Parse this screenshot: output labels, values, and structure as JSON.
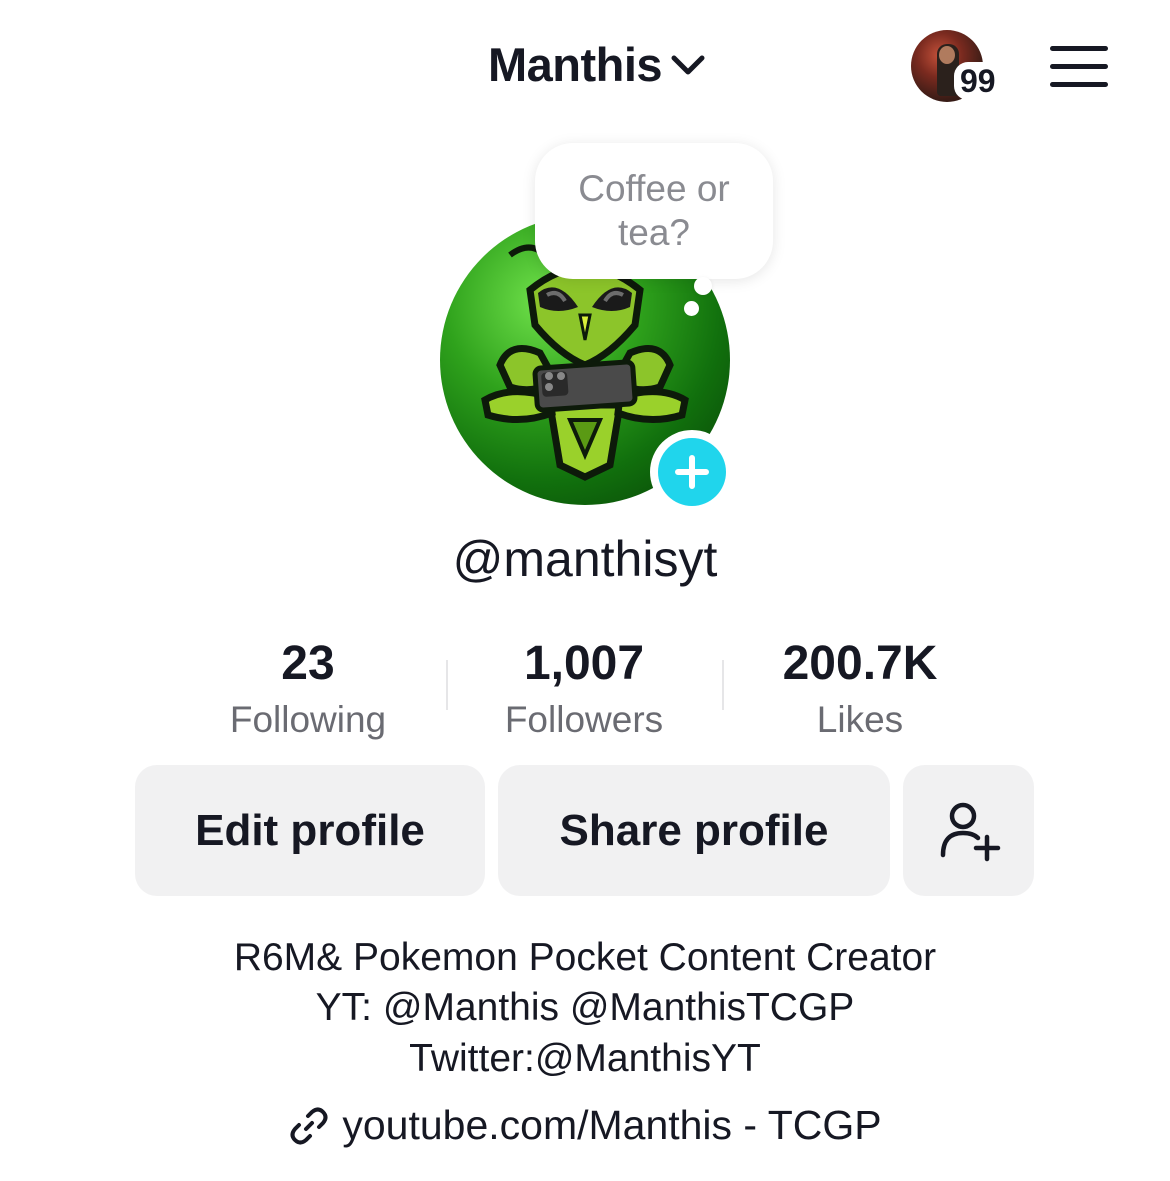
{
  "header": {
    "profile_name": "Manthis",
    "notification_count": "99"
  },
  "bubble": {
    "text": "Coffee or tea?"
  },
  "profile": {
    "username": "@manthisyt"
  },
  "stats": [
    {
      "value": "23",
      "label": "Following"
    },
    {
      "value": "1,007",
      "label": "Followers"
    },
    {
      "value": "200.7K",
      "label": "Likes"
    }
  ],
  "buttons": {
    "edit": "Edit profile",
    "share": "Share profile"
  },
  "bio": {
    "line1": "R6M& Pokemon Pocket Content Creator",
    "line2": "YT: @Manthis @ManthisTCGP",
    "line3": "Twitter:@ManthisYT"
  },
  "link": {
    "text": "youtube.com/Manthis - TCGP"
  },
  "colors": {
    "accent_add": "#20d5ec",
    "button_bg": "#f1f1f2",
    "avatar_green": "#2fa21c"
  },
  "icons": [
    "chevron-down-icon",
    "hamburger-menu-icon",
    "plus-icon",
    "add-friend-icon",
    "link-icon"
  ]
}
